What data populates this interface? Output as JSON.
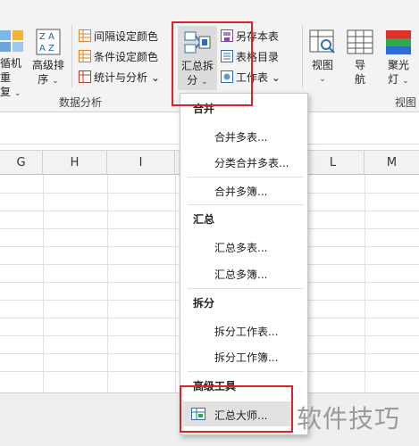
{
  "ribbon": {
    "partial_left": {
      "line1": "循机重",
      "line2": "复"
    },
    "advanced_sort": {
      "line1": "高级排",
      "line2": "序"
    },
    "small_buttons": {
      "interval_color": "间隔设定颜色",
      "condition_color": "条件设定颜色",
      "stats_analysis": "统计与分析"
    },
    "merge_split": {
      "line1": "汇总拆",
      "line2": "分"
    },
    "sheet_buttons": {
      "save_sheet": "另存本表",
      "sheet_directory": "表格目录",
      "worksheet": "工作表"
    },
    "view_buttons": {
      "view": "视图",
      "nav_line1": "导",
      "nav_line2": "航",
      "spotlight_line1": "聚光",
      "spotlight_line2": "灯"
    },
    "group_labels": {
      "data_analysis": "数据分析",
      "view": "视图"
    }
  },
  "grid": {
    "columns": [
      "G",
      "H",
      "I",
      "",
      "",
      "L",
      "M"
    ]
  },
  "dropdown": {
    "sections": [
      {
        "header": "合并",
        "items": [
          "合并多表...",
          "分类合并多表...",
          "合并多簿..."
        ]
      },
      {
        "header": "汇总",
        "items": [
          "汇总多表...",
          "汇总多簿..."
        ]
      },
      {
        "header": "拆分",
        "items": [
          "拆分工作表...",
          "拆分工作簿..."
        ]
      },
      {
        "header": "高级工具",
        "items": [
          "汇总大师..."
        ]
      }
    ]
  },
  "watermark": "软件技巧",
  "colors": {
    "highlight": "#e0202a",
    "ribbon_bg": "#f3f3f3",
    "hover_bg": "#e1e1e1"
  }
}
